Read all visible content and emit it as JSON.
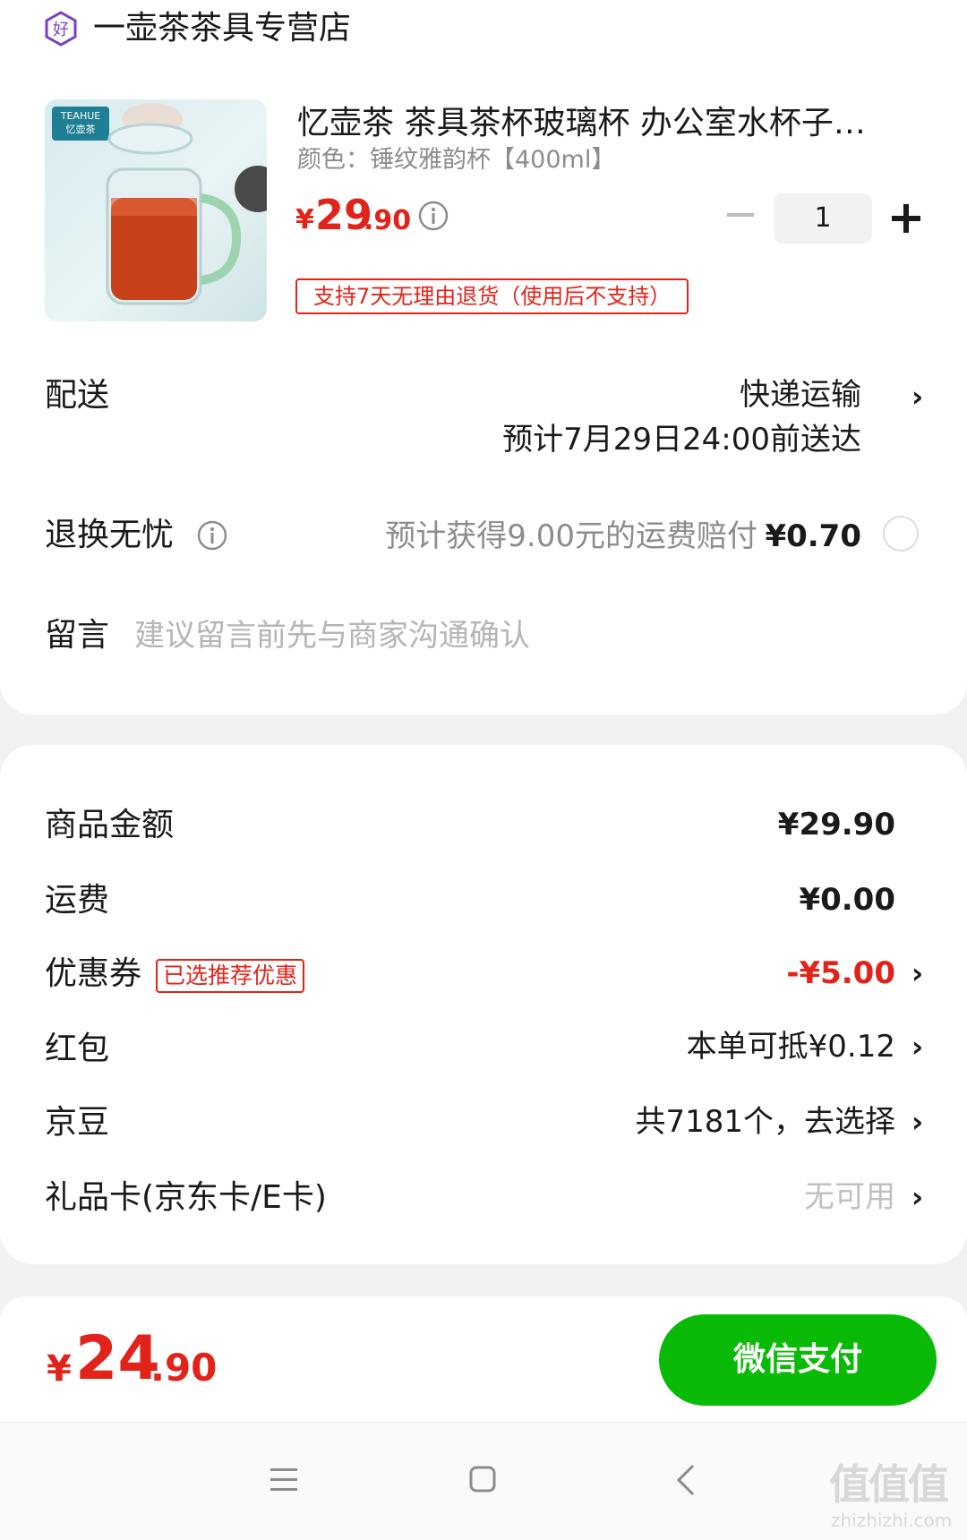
{
  "store": {
    "name": "一壶茶茶具专营店",
    "icon": "good-store-badge-icon"
  },
  "product": {
    "title": "忆壶茶 茶具茶杯玻璃杯 办公室水杯子男…",
    "variant": "颜色：锤纹雅韵杯【400ml】",
    "image_brand": "TEAHUE\n忆壶茶",
    "price_currency": "¥",
    "price_int": "29",
    "price_dec": ".90",
    "quantity": "1",
    "return_policy": "支持7天无理由退货（使用后不支持）"
  },
  "delivery": {
    "label": "配送",
    "method": "快递运输",
    "eta": "预计7月29日24:00前送达"
  },
  "return_insurance": {
    "label": "退换无忧",
    "desc": "预计获得9.00元的运费赔付",
    "price": "¥0.70"
  },
  "message": {
    "label": "留言",
    "placeholder": "建议留言前先与商家沟通确认"
  },
  "summary": {
    "goods_label": "商品金额",
    "goods_value": "¥29.90",
    "shipping_label": "运费",
    "shipping_value": "¥0.00",
    "coupon_label": "优惠券",
    "coupon_badge": "已选推荐优惠",
    "coupon_value": "-¥5.00",
    "redpacket_label": "红包",
    "redpacket_value": "本单可抵¥0.12",
    "jingdou_label": "京豆",
    "jingdou_value": "共7181个，去选择",
    "giftcard_label": "礼品卡(京东卡/E卡)",
    "giftcard_value": "无可用"
  },
  "footer": {
    "currency": "¥",
    "total_int": "24",
    "total_dec": ".90",
    "pay_label": "微信支付"
  },
  "watermark": {
    "logo": "值值值",
    "url": "zhizhizhi.com"
  },
  "colors": {
    "price_red": "#e2231a",
    "pay_green": "#09bb07",
    "store_icon_purple": "#7b3fc4"
  }
}
